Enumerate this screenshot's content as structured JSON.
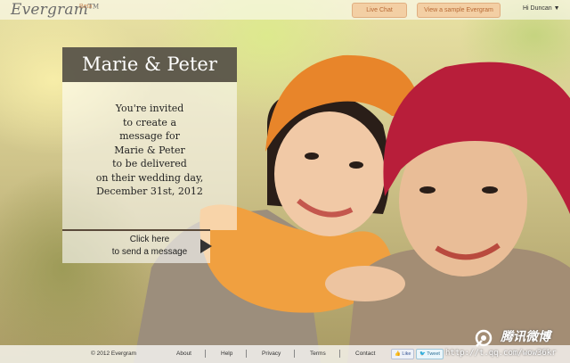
{
  "header": {
    "logo": "Evergram",
    "logo_tm": "TM",
    "beta": "Beta",
    "live_chat": "Live Chat",
    "sample": "View a sample Evergram",
    "user": "Hi Duncan ▼"
  },
  "card": {
    "title": "Marie & Peter",
    "lines": [
      "You're invited",
      "to create a",
      "message for",
      "Marie & Peter",
      "to be delivered",
      "on their wedding day,",
      "December 31st, 2012"
    ],
    "cta_line1": "Click here",
    "cta_line2": "to send a message"
  },
  "footer": {
    "copyright": "© 2012 Evergram",
    "about": "About",
    "help": "Help",
    "privacy": "Privacy",
    "terms": "Terms",
    "contact": "Contact",
    "like": "Like",
    "tweet": "Tweet"
  },
  "watermark": {
    "title": "腾讯微博",
    "url": "http://t.qq.com/wow36kr"
  },
  "colors": {
    "accent_button": "#f3cfa4",
    "title_bar": "#55504a",
    "hat_orange": "#e8852a",
    "hat_red": "#b81e3a"
  }
}
